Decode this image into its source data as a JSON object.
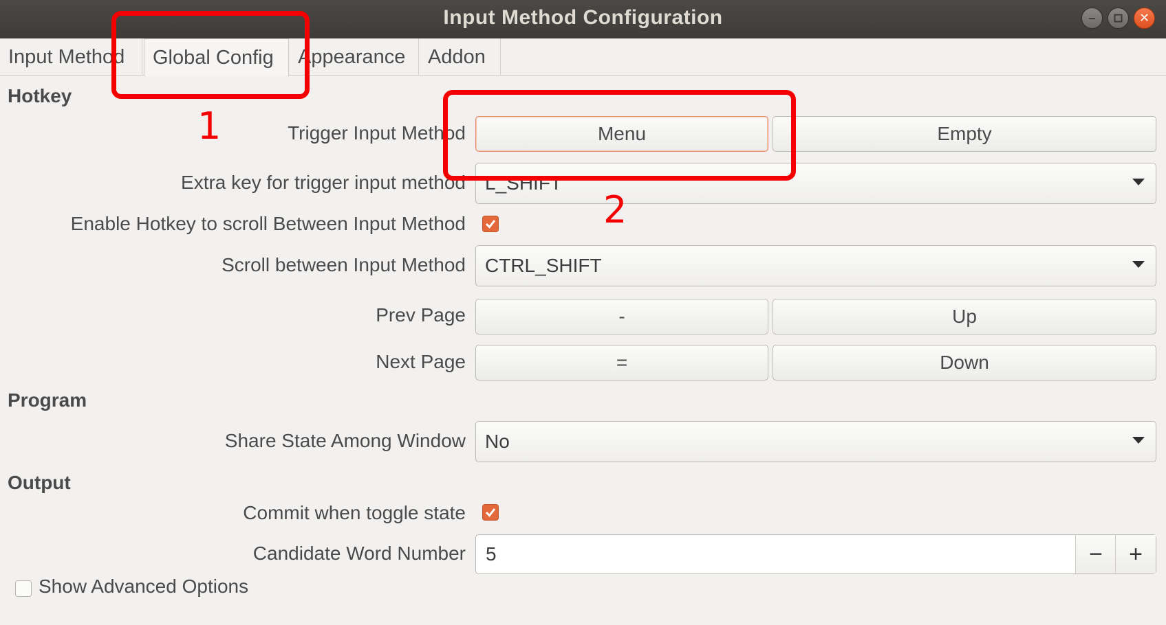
{
  "window": {
    "title": "Input Method Configuration",
    "controls": [
      "minimize-icon",
      "maximize-icon",
      "close-icon"
    ]
  },
  "tabs": [
    {
      "label": "Input Method",
      "active": false
    },
    {
      "label": "Global Config",
      "active": true
    },
    {
      "label": "Appearance",
      "active": false
    },
    {
      "label": "Addon",
      "active": false
    }
  ],
  "sections": {
    "hotkey": "Hotkey",
    "program": "Program",
    "output": "Output"
  },
  "hotkey": {
    "trigger": {
      "label": "Trigger Input Method",
      "key1": "Menu",
      "key2": "Empty"
    },
    "extra": {
      "label": "Extra key for trigger input method",
      "value": "L_SHIFT"
    },
    "enable_scroll": {
      "label": "Enable Hotkey to scroll Between Input Method",
      "checked": true
    },
    "scroll": {
      "label": "Scroll between Input Method",
      "value": "CTRL_SHIFT"
    },
    "prev_page": {
      "label": "Prev Page",
      "key1": "-",
      "key2": "Up"
    },
    "next_page": {
      "label": "Next Page",
      "key1": "=",
      "key2": "Down"
    }
  },
  "program": {
    "share_state": {
      "label": "Share State Among Window",
      "value": "No"
    }
  },
  "output": {
    "commit_toggle": {
      "label": "Commit when toggle state",
      "checked": true
    },
    "candidate_number": {
      "label": "Candidate Word Number",
      "value": "5",
      "minus": "−",
      "plus": "+"
    }
  },
  "advanced": {
    "label": "Show Advanced Options",
    "checked": false
  },
  "annotations": [
    {
      "number": "1",
      "color": "#f40000"
    },
    {
      "number": "2",
      "color": "#f40000"
    }
  ],
  "colors": {
    "accent": "#e4693a",
    "annotation": "#f40000",
    "titlebar": "#3d3c39"
  }
}
